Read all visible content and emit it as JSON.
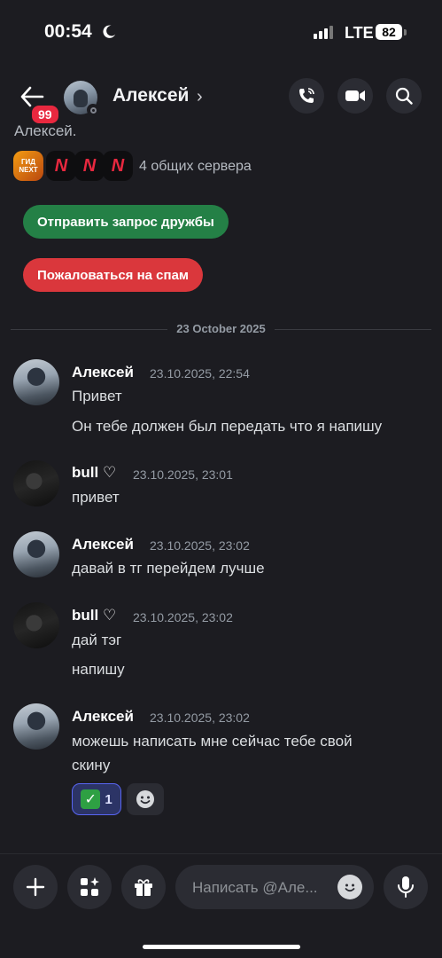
{
  "status_bar": {
    "time": "00:54",
    "network": "LTE",
    "battery": "82"
  },
  "header": {
    "badge": "99",
    "name": "Алексей",
    "chevron": "›"
  },
  "profile": {
    "intro_cut": "Алексей.",
    "servers": [
      "ГИД NEXT",
      "N",
      "N",
      "N"
    ],
    "shared_servers": "4 общих сервера",
    "friend_request_label": "Отправить запрос дружбы",
    "report_spam_label": "Пожаловаться на спам"
  },
  "divider": {
    "date": "23 October 2025"
  },
  "messages": [
    {
      "author": "Алексей",
      "time": "23.10.2025, 22:54",
      "lines": [
        "Привет",
        "Он тебе должен был передать что я напишу"
      ]
    },
    {
      "author": "bull ♡",
      "time": "23.10.2025, 23:01",
      "lines": [
        "привет"
      ]
    },
    {
      "author": "Алексей",
      "time": "23.10.2025, 23:02",
      "lines": [
        "давай в тг перейдем лучше"
      ]
    },
    {
      "author": "bull ♡",
      "time": "23.10.2025, 23:02",
      "lines": [
        "дай тэг",
        "напишу"
      ]
    },
    {
      "author": "Алексей",
      "time": "23.10.2025, 23:02",
      "lines": [
        "можешь написать мне сейчас тебе свой",
        "скину"
      ]
    }
  ],
  "reaction": {
    "emoji": "✓",
    "count": "1"
  },
  "composer": {
    "placeholder": "Написать @Але..."
  },
  "colors": {
    "background": "#1c1c21",
    "friend_button": "#248046",
    "spam_button": "#da373c",
    "badge": "#e8283f",
    "reaction_border": "#5865f2"
  }
}
